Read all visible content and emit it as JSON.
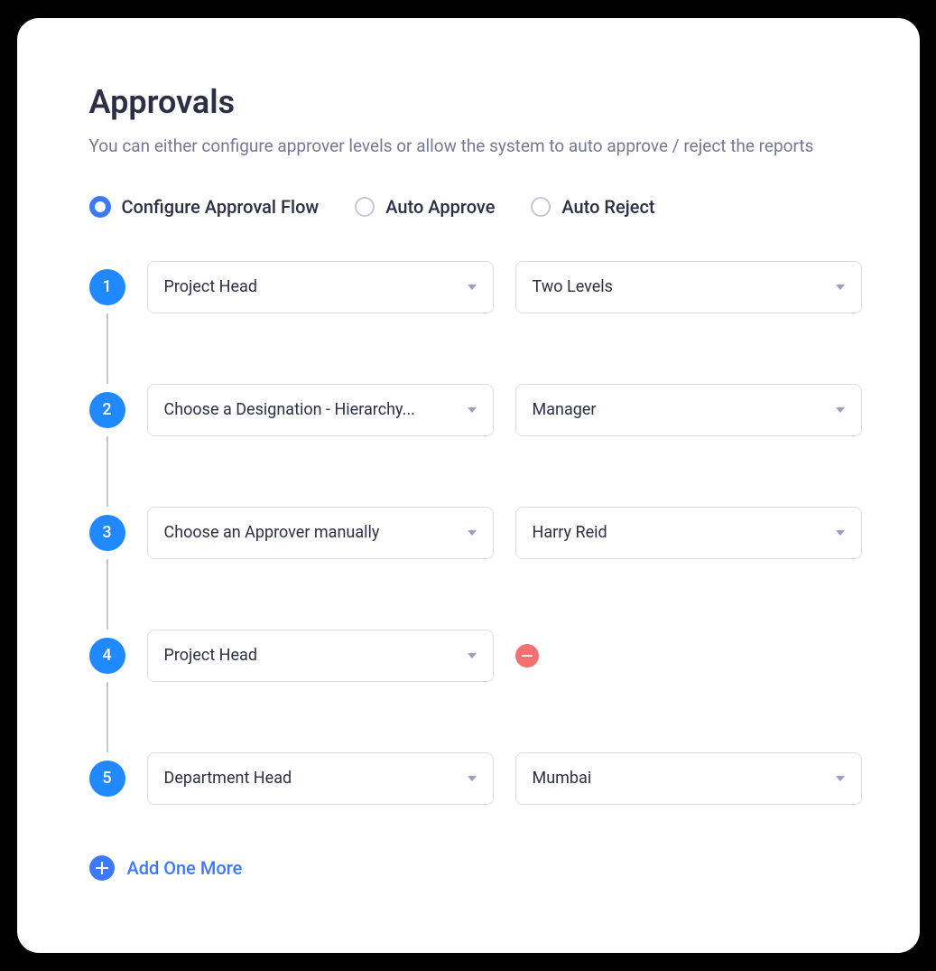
{
  "header": {
    "title": "Approvals",
    "subtitle": "You can either configure approver levels  or allow the system to auto approve / reject the reports"
  },
  "radio": {
    "configure": "Configure Approval Flow",
    "auto_approve": "Auto Approve",
    "auto_reject": "Auto Reject"
  },
  "steps": {
    "s1": {
      "num": "1",
      "d1": "Project Head",
      "d2": "Two Levels"
    },
    "s2": {
      "num": "2",
      "d1": "Choose a Designation - Hierarchy...",
      "d2": "Manager"
    },
    "s3": {
      "num": "3",
      "d1": "Choose an Approver manually",
      "d2": "Harry Reid"
    },
    "s4": {
      "num": "4",
      "d1": "Project Head"
    },
    "s5": {
      "num": "5",
      "d1": "Department Head",
      "d2": "Mumbai"
    }
  },
  "add_more": "Add One More"
}
